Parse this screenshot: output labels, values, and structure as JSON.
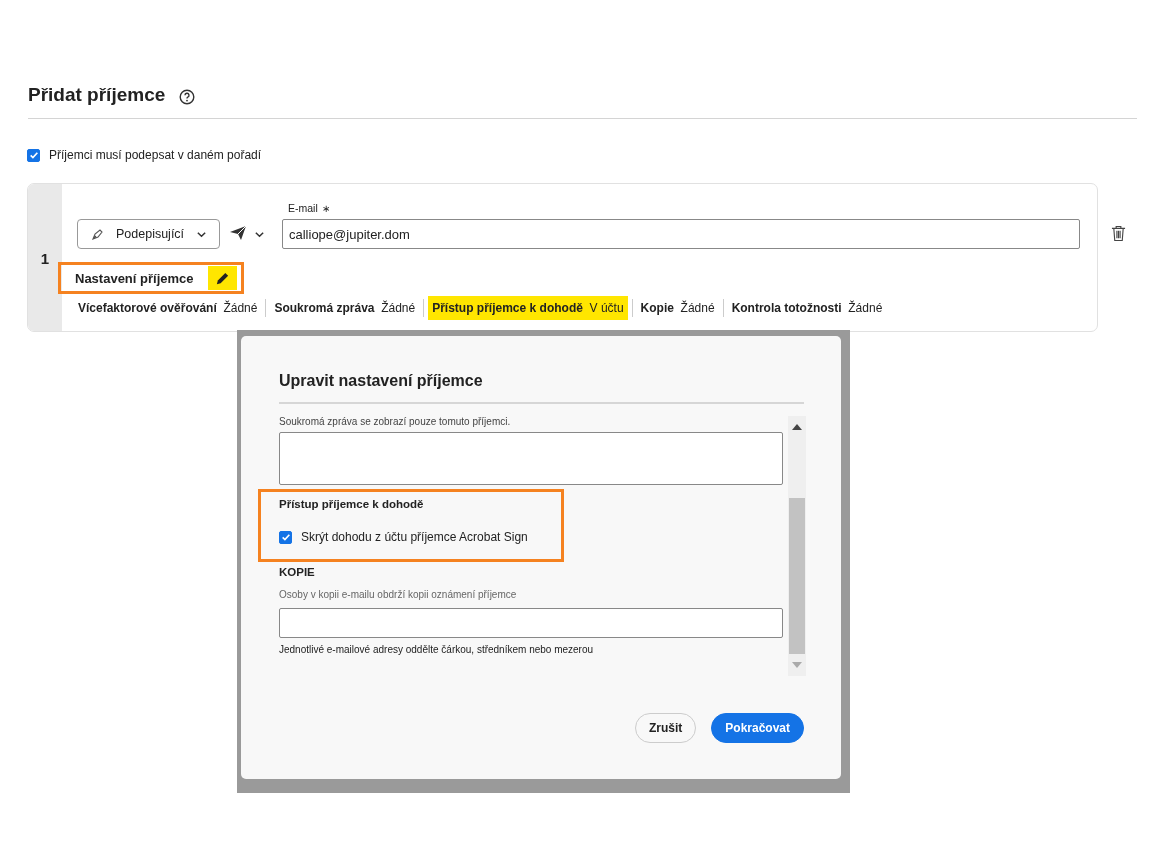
{
  "page": {
    "title": "Přidat příjemce",
    "sign_in_order": {
      "label": "Příjemci musí podepsat v daném pořadí",
      "checked": true
    },
    "recipients": [
      {
        "number": "1",
        "role": "Podepisující",
        "email_label": "E-mail",
        "required_mark": "∗",
        "email": "calliope@jupiter.dom",
        "settings_heading": {
          "label": "Nastavení příjemce",
          "outlined": true,
          "edit_highlighted": true
        },
        "settings": [
          {
            "label": "Vícefaktorové ověřování",
            "value": "Žádné",
            "highlighted": false
          },
          {
            "label": "Soukromá zpráva",
            "value": "Žádné",
            "highlighted": false
          },
          {
            "label": "Přístup příjemce k dohodě",
            "value": "V účtu",
            "highlighted": true
          },
          {
            "label": "Kopie",
            "value": "Žádné",
            "highlighted": false
          },
          {
            "label": "Kontrola totožnosti",
            "value": "Žádné",
            "highlighted": false
          }
        ]
      }
    ]
  },
  "dialog": {
    "title": "Upravit nastavení příjemce",
    "private_message_hint": "Soukromá zpráva se zobrazí pouze tomuto příjemci.",
    "access": {
      "heading": "Přístup příjemce k dohodě",
      "outlined": true,
      "checkbox": {
        "label": "Skrýt dohodu z účtu příjemce Acrobat Sign",
        "checked": true
      }
    },
    "copies": {
      "heading": "KOPIE",
      "hint": "Osoby v kopii e-mailu obdrží kopii oznámení příjemce",
      "note": "Jednotlivé e-mailové adresy oddělte čárkou, středníkem nebo mezerou"
    },
    "buttons": [
      {
        "label": "Zrušit",
        "kind": "secondary"
      },
      {
        "label": "Pokračovat",
        "kind": "primary"
      }
    ]
  }
}
